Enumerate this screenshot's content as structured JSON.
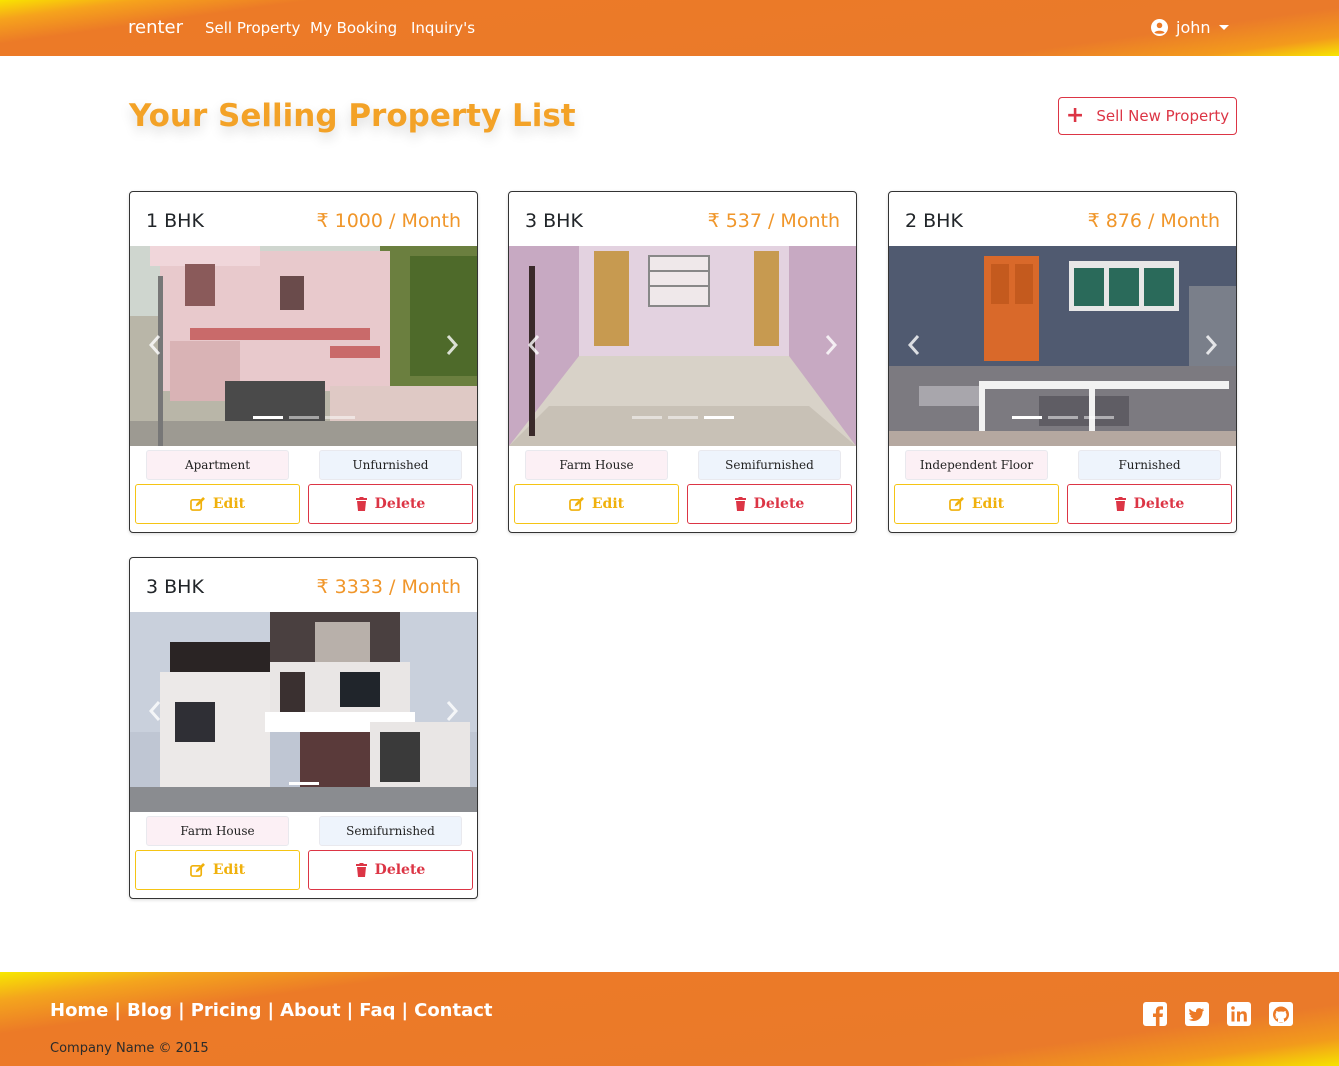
{
  "navbar": {
    "brand": "renter",
    "links": [
      "Sell Property",
      "My Booking",
      "Inquiry's"
    ],
    "user": "john"
  },
  "header": {
    "title": "Your Selling Property List",
    "sell_button": "Sell New Property"
  },
  "properties": [
    {
      "bhk": "1 BHK",
      "price": "₹ 1000 / Month",
      "type": "Apartment",
      "furnishing": "Unfurnished",
      "slides": 3,
      "active_slide": 0,
      "image": "two-story-house"
    },
    {
      "bhk": "3 BHK",
      "price": "₹ 537 / Month",
      "type": "Farm House",
      "furnishing": "Semifurnished",
      "slides": 3,
      "active_slide": 2,
      "image": "empty-room-interior"
    },
    {
      "bhk": "2 BHK",
      "price": "₹ 876 / Month",
      "type": "Independent Floor",
      "furnishing": "Furnished",
      "slides": 3,
      "active_slide": 0,
      "image": "house-entrance-porch"
    },
    {
      "bhk": "3 BHK",
      "price": "₹ 3333 / Month",
      "type": "Farm House",
      "furnishing": "Semifurnished",
      "slides": 1,
      "active_slide": 0,
      "image": "modern-villa"
    }
  ],
  "card_actions": {
    "edit": "Edit",
    "delete": "Delete"
  },
  "footer": {
    "links": [
      "Home",
      "Blog",
      "Pricing",
      "About",
      "Faq",
      "Contact"
    ],
    "copyright": "Company Name © 2015",
    "socials": [
      "facebook-icon",
      "twitter-icon",
      "linkedin-icon",
      "github-icon"
    ]
  },
  "colors": {
    "accent_orange": "#ea7a2a",
    "title_orange": "#f3a227",
    "danger": "#dc3545",
    "warning": "#f0b10c"
  }
}
